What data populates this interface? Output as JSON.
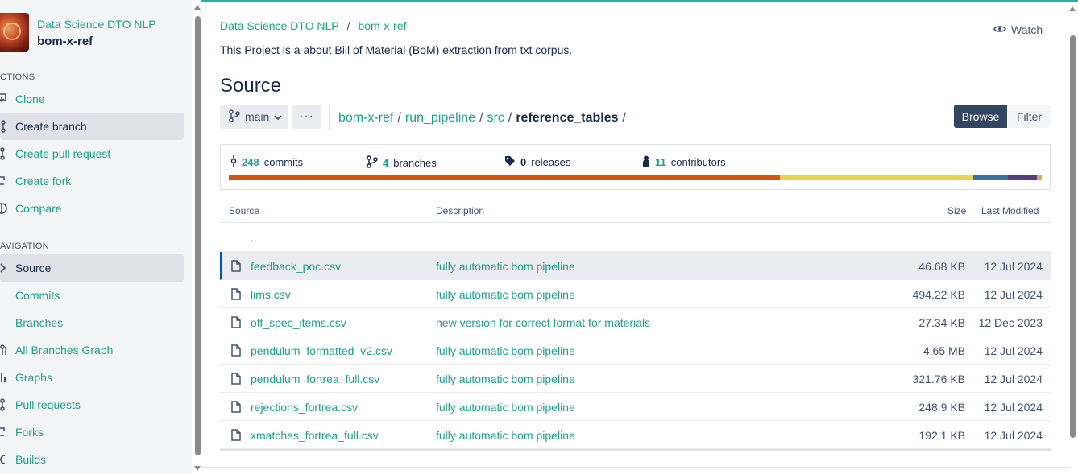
{
  "project": {
    "group": "Data Science DTO NLP",
    "name": "bom-x-ref",
    "description": "This Project is a about Bill of Material (BoM) extraction from txt corpus."
  },
  "sidebar": {
    "actions_label": "CTIONS",
    "navigation_label": "AVIGATION",
    "actions": [
      {
        "label": "Clone",
        "icon": "clone-icon"
      },
      {
        "label": "Create branch",
        "icon": "branch-icon"
      },
      {
        "label": "Create pull request",
        "icon": "pull-request-icon"
      },
      {
        "label": "Create fork",
        "icon": "fork-icon"
      },
      {
        "label": "Compare",
        "icon": "compare-icon"
      }
    ],
    "navigation": [
      {
        "label": "Source",
        "icon": "chevron-right-icon"
      },
      {
        "label": "Commits",
        "icon": "commit-icon"
      },
      {
        "label": "Branches",
        "icon": "branch-icon"
      },
      {
        "label": "All Branches Graph",
        "icon": "graph-icon"
      },
      {
        "label": "Graphs",
        "icon": "chart-icon"
      },
      {
        "label": "Pull requests",
        "icon": "pull-request-icon"
      },
      {
        "label": "Forks",
        "icon": "fork-icon"
      },
      {
        "label": "Builds",
        "icon": "builds-icon"
      }
    ]
  },
  "header": {
    "breadcrumb": [
      "Data Science DTO NLP",
      "bom-x-ref"
    ],
    "breadcrumb_sep": "/",
    "watch_label": "Watch",
    "title": "Source"
  },
  "toolbar": {
    "branch": "main",
    "more": "···",
    "path": [
      "bom-x-ref",
      "run_pipeline",
      "src"
    ],
    "current": "reference_tables",
    "path_sep": "/",
    "browse_label": "Browse",
    "filter_label": "Filter"
  },
  "stats": {
    "commits": {
      "count": "248",
      "label": "commits"
    },
    "branches": {
      "count": "4",
      "label": "branches"
    },
    "releases": {
      "count": "0",
      "label": "releases"
    },
    "contributors": {
      "count": "11",
      "label": "contributors"
    },
    "language_bar": [
      {
        "color": "#d4560e",
        "fraction": 0.678
      },
      {
        "color": "#e8d44d",
        "fraction": 0.238
      },
      {
        "color": "#3572a5",
        "fraction": 0.042
      },
      {
        "color": "#563d7c",
        "fraction": 0.036
      },
      {
        "color": "#e3a35a",
        "fraction": 0.006
      }
    ]
  },
  "table": {
    "columns": {
      "source": "Source",
      "description": "Description",
      "size": "Size",
      "modified": "Last Modified"
    },
    "parent": "..",
    "rows": [
      {
        "name": "feedback_poc.csv",
        "description": "fully automatic bom pipeline",
        "size": "46.68 KB",
        "date": "12 Jul 2024"
      },
      {
        "name": "lims.csv",
        "description": "fully automatic bom pipeline",
        "size": "494.22 KB",
        "date": "12 Jul 2024"
      },
      {
        "name": "off_spec_items.csv",
        "description": "new version for correct format for materials",
        "size": "27.34 KB",
        "date": "12 Dec 2023"
      },
      {
        "name": "pendulum_formatted_v2.csv",
        "description": "fully automatic bom pipeline",
        "size": "4.65 MB",
        "date": "12 Jul 2024"
      },
      {
        "name": "pendulum_fortrea_full.csv",
        "description": "fully automatic bom pipeline",
        "size": "321.76 KB",
        "date": "12 Jul 2024"
      },
      {
        "name": "rejections_fortrea.csv",
        "description": "fully automatic bom pipeline",
        "size": "248.9 KB",
        "date": "12 Jul 2024"
      },
      {
        "name": "xmatches_fortrea_full.csv",
        "description": "fully automatic bom pipeline",
        "size": "192.1 KB",
        "date": "12 Jul 2024"
      }
    ]
  },
  "colors": {
    "accent": "#1f9e8a",
    "primary_button": "#344563",
    "text": "#172b4d"
  }
}
